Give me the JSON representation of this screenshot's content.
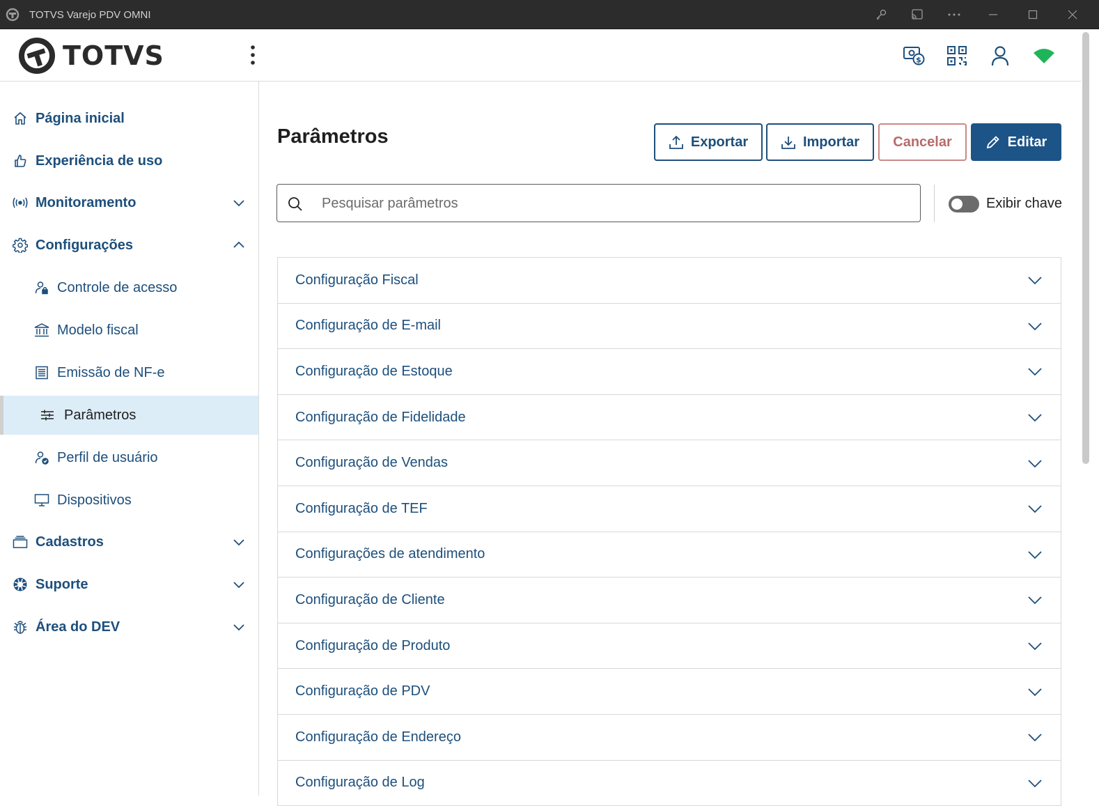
{
  "window": {
    "title": "TOTVS Varejo PDV OMNI"
  },
  "header": {
    "logo_text": "TOTVS"
  },
  "sidebar": {
    "items": [
      {
        "label": "Página inicial"
      },
      {
        "label": "Experiência de uso"
      },
      {
        "label": "Monitoramento"
      },
      {
        "label": "Configurações"
      },
      {
        "label": "Controle de acesso"
      },
      {
        "label": "Modelo fiscal"
      },
      {
        "label": "Emissão de NF-e"
      },
      {
        "label": "Parâmetros"
      },
      {
        "label": "Perfil de usuário"
      },
      {
        "label": "Dispositivos"
      },
      {
        "label": "Cadastros"
      },
      {
        "label": "Suporte"
      },
      {
        "label": "Área do DEV"
      }
    ]
  },
  "main": {
    "title": "Parâmetros",
    "buttons": {
      "export": "Exportar",
      "import": "Importar",
      "cancel": "Cancelar",
      "edit": "Editar"
    },
    "search": {
      "placeholder": "Pesquisar parâmetros",
      "value": ""
    },
    "toggle": {
      "label": "Exibir chave",
      "on": false
    },
    "sections": [
      {
        "label": "Configuração Fiscal"
      },
      {
        "label": "Configuração de E-mail"
      },
      {
        "label": "Configuração de Estoque"
      },
      {
        "label": "Configuração de Fidelidade"
      },
      {
        "label": "Configuração de Vendas"
      },
      {
        "label": "Configuração de TEF"
      },
      {
        "label": "Configurações de atendimento"
      },
      {
        "label": "Configuração de Cliente"
      },
      {
        "label": "Configuração de Produto"
      },
      {
        "label": "Configuração de PDV"
      },
      {
        "label": "Configuração de Endereço"
      },
      {
        "label": "Configuração de Log"
      }
    ]
  },
  "colors": {
    "brand_blue": "#1d4f7c",
    "primary_button": "#1c5488",
    "cancel": "#b86a6a",
    "active_nav_bg": "#dcedf8",
    "online_indicator": "#1fb45a"
  }
}
